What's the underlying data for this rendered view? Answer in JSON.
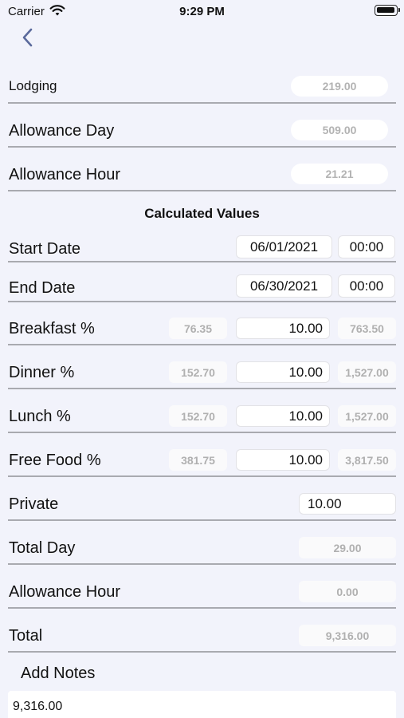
{
  "status_bar": {
    "carrier": "Carrier",
    "time": "9:29 PM"
  },
  "nav": {
    "back_icon": "chevron-left-icon"
  },
  "rates": {
    "lodging": {
      "label": "Lodging",
      "value": "219.00"
    },
    "allowance_day": {
      "label": "Allowance Day",
      "value": "509.00"
    },
    "allowance_hour": {
      "label": "Allowance Hour",
      "value": "21.21"
    }
  },
  "calculated": {
    "title": "Calculated Values",
    "start_date": {
      "label": "Start Date",
      "date": "06/01/2021",
      "time": "00:00"
    },
    "end_date": {
      "label": "End Date",
      "date": "06/30/2021",
      "time": "00:00"
    },
    "meals": [
      {
        "label": "Breakfast %",
        "base": "76.35",
        "percent": "10.00",
        "total": "763.50"
      },
      {
        "label": "Dinner %",
        "base": "152.70",
        "percent": "10.00",
        "total": "1,527.00"
      },
      {
        "label": "Lunch %",
        "base": "152.70",
        "percent": "10.00",
        "total": "1,527.00"
      },
      {
        "label": "Free Food %",
        "base": "381.75",
        "percent": "10.00",
        "total": "3,817.50"
      }
    ],
    "private": {
      "label": "Private",
      "value": "10.00"
    },
    "total_day": {
      "label": "Total Day",
      "value": "29.00"
    },
    "allowance_hour": {
      "label": "Allowance Hour",
      "value": "0.00"
    },
    "total": {
      "label": "Total",
      "value": "9,316.00"
    }
  },
  "notes": {
    "title": "Add Notes",
    "value": "9,316.00"
  }
}
